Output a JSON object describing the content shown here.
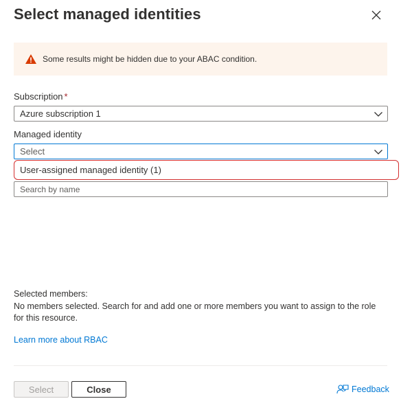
{
  "header": {
    "title": "Select managed identities"
  },
  "warning": {
    "text": "Some results might be hidden due to your ABAC condition.",
    "icon": "warning-icon",
    "color": "#fdf4ec"
  },
  "subscription": {
    "label": "Subscription",
    "required_marker": "*",
    "value": "Azure subscription 1"
  },
  "managed_identity": {
    "label": "Managed identity",
    "placeholder": "Select",
    "options": [
      "User-assigned managed identity (1)"
    ]
  },
  "search": {
    "placeholder": "Search by name"
  },
  "selected_members": {
    "heading": "Selected members:",
    "text": "No members selected. Search for and add one or more members you want to assign to the role for this resource."
  },
  "links": {
    "learn_more": "Learn more about RBAC"
  },
  "footer": {
    "select_label": "Select",
    "close_label": "Close",
    "feedback_label": "Feedback"
  },
  "colors": {
    "accent": "#0078d4",
    "highlight_border": "#d32f2f",
    "warning_icon": "#d83b01"
  }
}
